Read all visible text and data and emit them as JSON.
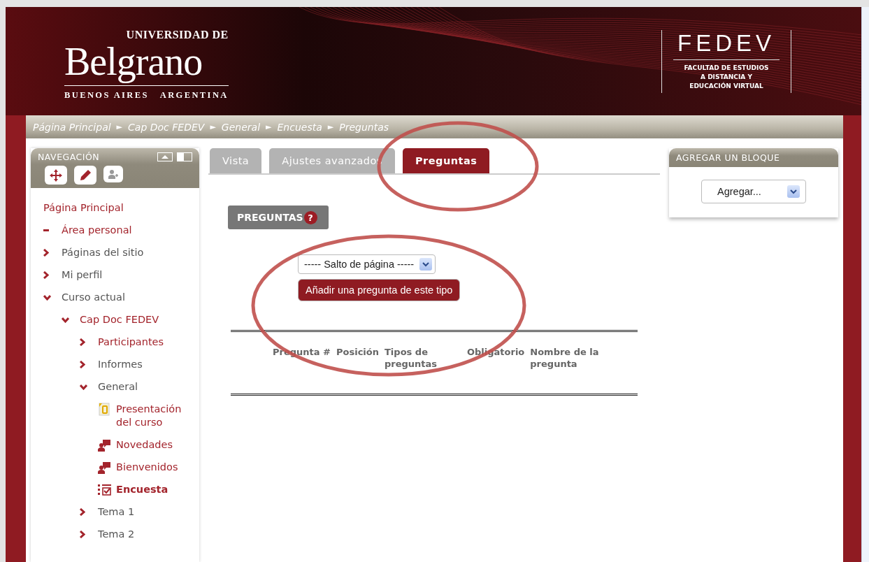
{
  "header": {
    "logo": {
      "top": "UNIVERSIDAD DE",
      "name": "Belgrano",
      "bottom": "BUENOS AIRES   ARGENTINA"
    },
    "faculty": {
      "acronym": "FEDEV",
      "lines": [
        "FACULTAD DE ESTUDIOS",
        "A DISTANCIA Y",
        "EDUCACIÓN VIRTUAL"
      ]
    }
  },
  "breadcrumb": [
    "Página Principal",
    "Cap Doc FEDEV",
    "General",
    "Encuesta",
    "Preguntas"
  ],
  "breadcrumb_separator": "►",
  "navigation": {
    "title": "NAVEGACIÓN",
    "items": [
      {
        "label": "Página Principal",
        "kind": "root",
        "linked": true,
        "selected": false
      },
      {
        "label": "Área personal",
        "kind": "leaf",
        "linked": true,
        "selected": false
      },
      {
        "label": "Páginas del sitio",
        "kind": "branch",
        "expanded": false,
        "linked": false,
        "selected": false
      },
      {
        "label": "Mi perfil",
        "kind": "branch",
        "expanded": false,
        "linked": false,
        "selected": false
      },
      {
        "label": "Curso actual",
        "kind": "branch",
        "expanded": true,
        "linked": false,
        "selected": false,
        "children": [
          {
            "label": "Cap Doc FEDEV",
            "kind": "branch",
            "expanded": true,
            "linked": true,
            "selected": false,
            "children": [
              {
                "label": "Participantes",
                "kind": "branch",
                "expanded": false,
                "linked": true,
                "selected": false
              },
              {
                "label": "Informes",
                "kind": "branch",
                "expanded": false,
                "linked": false,
                "selected": false
              },
              {
                "label": "General",
                "kind": "branch",
                "expanded": true,
                "linked": false,
                "selected": false,
                "children": [
                  {
                    "label": "Presentación del curso",
                    "kind": "page",
                    "linked": true,
                    "selected": false
                  },
                  {
                    "label": "Novedades",
                    "kind": "forum",
                    "linked": true,
                    "selected": false
                  },
                  {
                    "label": "Bienvenidos",
                    "kind": "forum",
                    "linked": true,
                    "selected": false
                  },
                  {
                    "label": "Encuesta",
                    "kind": "survey",
                    "linked": true,
                    "selected": true
                  }
                ]
              },
              {
                "label": "Tema 1",
                "kind": "branch",
                "expanded": false,
                "linked": false,
                "selected": false
              },
              {
                "label": "Tema 2",
                "kind": "branch",
                "expanded": false,
                "linked": false,
                "selected": false
              }
            ]
          }
        ]
      }
    ]
  },
  "tabs": [
    {
      "label": "Vista",
      "selected": false
    },
    {
      "label": "Ajustes avanzados",
      "selected": false
    },
    {
      "label": "Preguntas",
      "selected": true
    }
  ],
  "section": {
    "title": "PREGUNTAS",
    "help": "?",
    "question_type": {
      "value": "----- Salto de página -----"
    },
    "add_button": "Añadir una pregunta de este tipo"
  },
  "table": {
    "columns": [
      "Pregunta #",
      "Posición",
      "Tipos de preguntas",
      "Obligatorio",
      "Nombre de la pregunta"
    ]
  },
  "add_block": {
    "title": "AGREGAR UN BLOQUE",
    "select": {
      "value": "Agregar..."
    }
  },
  "annotations": [
    {
      "kind": "ellipse"
    },
    {
      "kind": "ellipse"
    }
  ]
}
